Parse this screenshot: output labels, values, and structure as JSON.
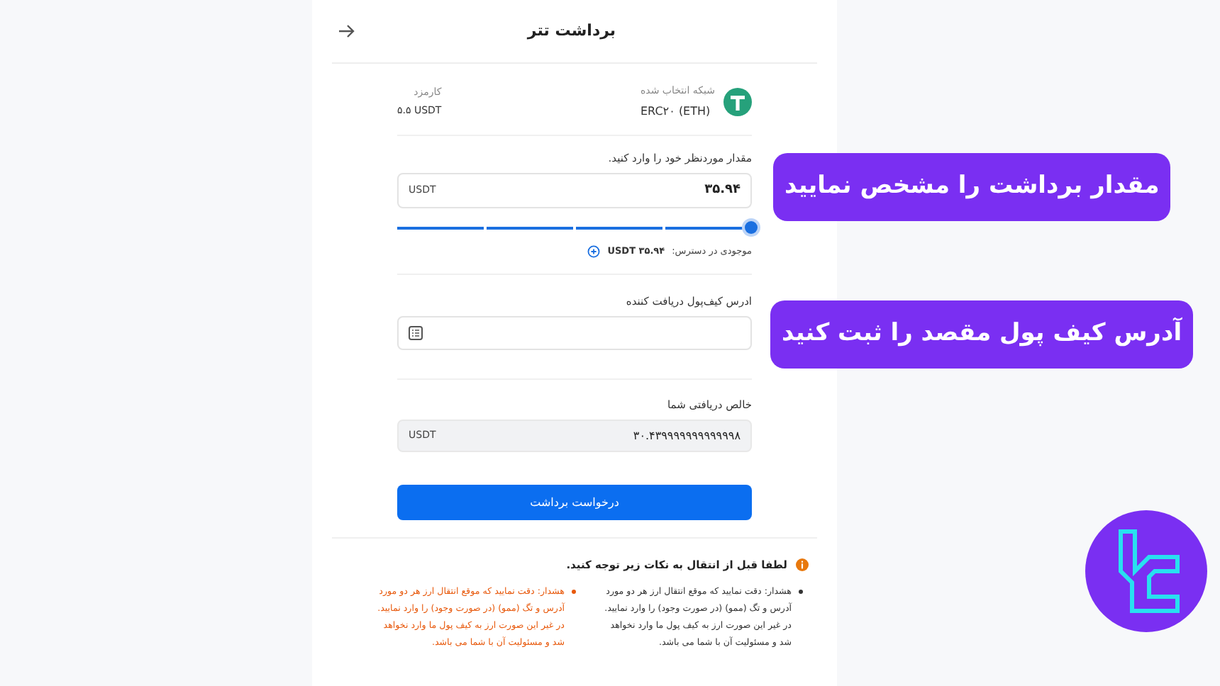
{
  "header": {
    "title": "برداشت تتر"
  },
  "network": {
    "label": "شبکه انتخاب شده",
    "value": "ERC۲۰ (ETH)"
  },
  "fee": {
    "label": "کارمزد",
    "value": "۵.۵ USDT"
  },
  "amount": {
    "label": "مقدار موردنظر خود را وارد کنید.",
    "value": "۳۵.۹۴",
    "unit": "USDT"
  },
  "slider": {
    "level": 1
  },
  "available": {
    "label": "موجودی در دسترس:",
    "value": "USDT ۳۵.۹۴"
  },
  "address": {
    "label": "ادرس کیف‌پول دریافت کننده"
  },
  "net": {
    "label": "خالص دریافتی شما",
    "value": "۳۰.۴۳۹۹۹۹۹۹۹۹۹۹۹۹۸",
    "unit": "USDT"
  },
  "submit": {
    "label": "درخواست برداشت"
  },
  "notice": {
    "title": "لطفا قبل از انتقال به نکات زیر توجه کنید.",
    "items": [
      {
        "text": "هشدار: دقت نمایید که موقع انتقال ارز هر دو مورد آدرس و تگ (ممو) (در صورت وجود) را وارد نمایید. در غیر این صورت ارز به کیف پول ما وارد نخواهد شد و مسئولیت آن با شما می باشد.",
        "color": "#333333"
      },
      {
        "text": "هشدار: دقت نمایید که موقع انتقال ارز هر دو مورد آدرس و تگ (ممو) (در صورت وجود) را وارد نمایید. در غیر این صورت ارز به کیف پول ما وارد نخواهد شد و مسئولیت آن با شما می باشد.",
        "color": "#e8590c"
      }
    ]
  },
  "callouts": [
    "مقدار برداشت را مشخص نمایید",
    "آدرس کیف پول مقصد را ثبت کنید"
  ]
}
